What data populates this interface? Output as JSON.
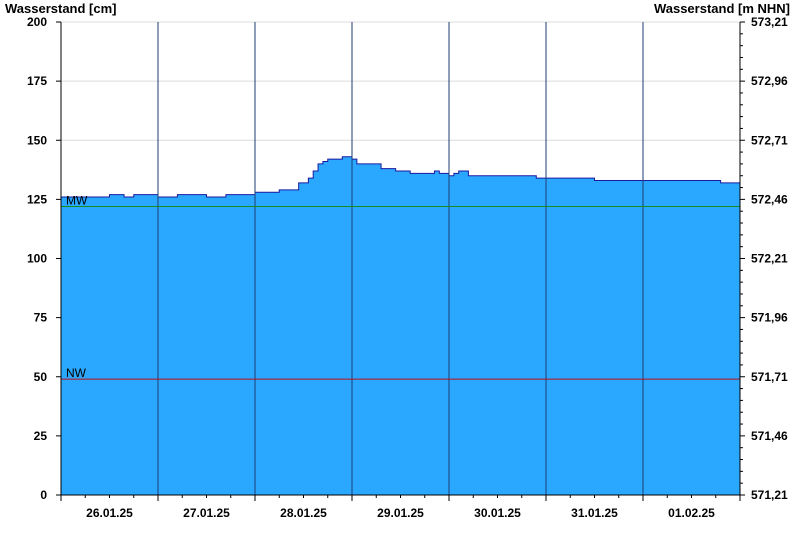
{
  "chart_data": {
    "type": "area",
    "ylabel": "Wasserstand [cm]",
    "ylabel_right": "Wasserstand [m NHN]",
    "ylim": [
      0,
      200
    ],
    "yticks": [
      0,
      25,
      50,
      75,
      100,
      125,
      150,
      175,
      200
    ],
    "ytick_labels_right": [
      "571,21",
      "571,46",
      "571,71",
      "571,96",
      "572,21",
      "572,46",
      "572,71",
      "572,96",
      "573,21"
    ],
    "xlim_days": [
      0,
      7
    ],
    "x_ticks": [
      "26.01.25",
      "27.01.25",
      "28.01.25",
      "29.01.25",
      "30.01.25",
      "31.01.25",
      "01.02.25"
    ],
    "grid": true,
    "fill_color": "#2aa7ff",
    "line_color": "#1a1aa0",
    "reference_lines": [
      {
        "label": "MW",
        "value": 122,
        "color": "#1a8a1a"
      },
      {
        "label": "NW",
        "value": 49,
        "color": "#c01010"
      }
    ],
    "series": [
      {
        "x": [
          0,
          0.05,
          0.25,
          0.5,
          0.65,
          0.75,
          0.85,
          1.0,
          1.2,
          1.3,
          1.5,
          1.7,
          1.8,
          2.0,
          2.1,
          2.25,
          2.45,
          2.55,
          2.6,
          2.65,
          2.7,
          2.75,
          2.8,
          2.9,
          3.0,
          3.05,
          3.1,
          3.15,
          3.3,
          3.45,
          3.6,
          3.8,
          3.85,
          3.9,
          4.0,
          4.05,
          4.1,
          4.2,
          4.5,
          4.9,
          5.5,
          6.0,
          6.2,
          6.8,
          7.0
        ],
        "values": [
          126,
          126,
          126,
          127,
          126,
          127,
          127,
          126,
          127,
          127,
          126,
          127,
          127,
          128,
          128,
          129,
          132,
          134,
          137,
          140,
          141,
          142,
          142,
          143,
          142,
          140,
          140,
          140,
          138,
          137,
          136,
          136,
          137,
          136,
          135,
          136,
          137,
          135,
          135,
          134,
          133,
          133,
          133,
          132,
          131
        ]
      }
    ]
  }
}
